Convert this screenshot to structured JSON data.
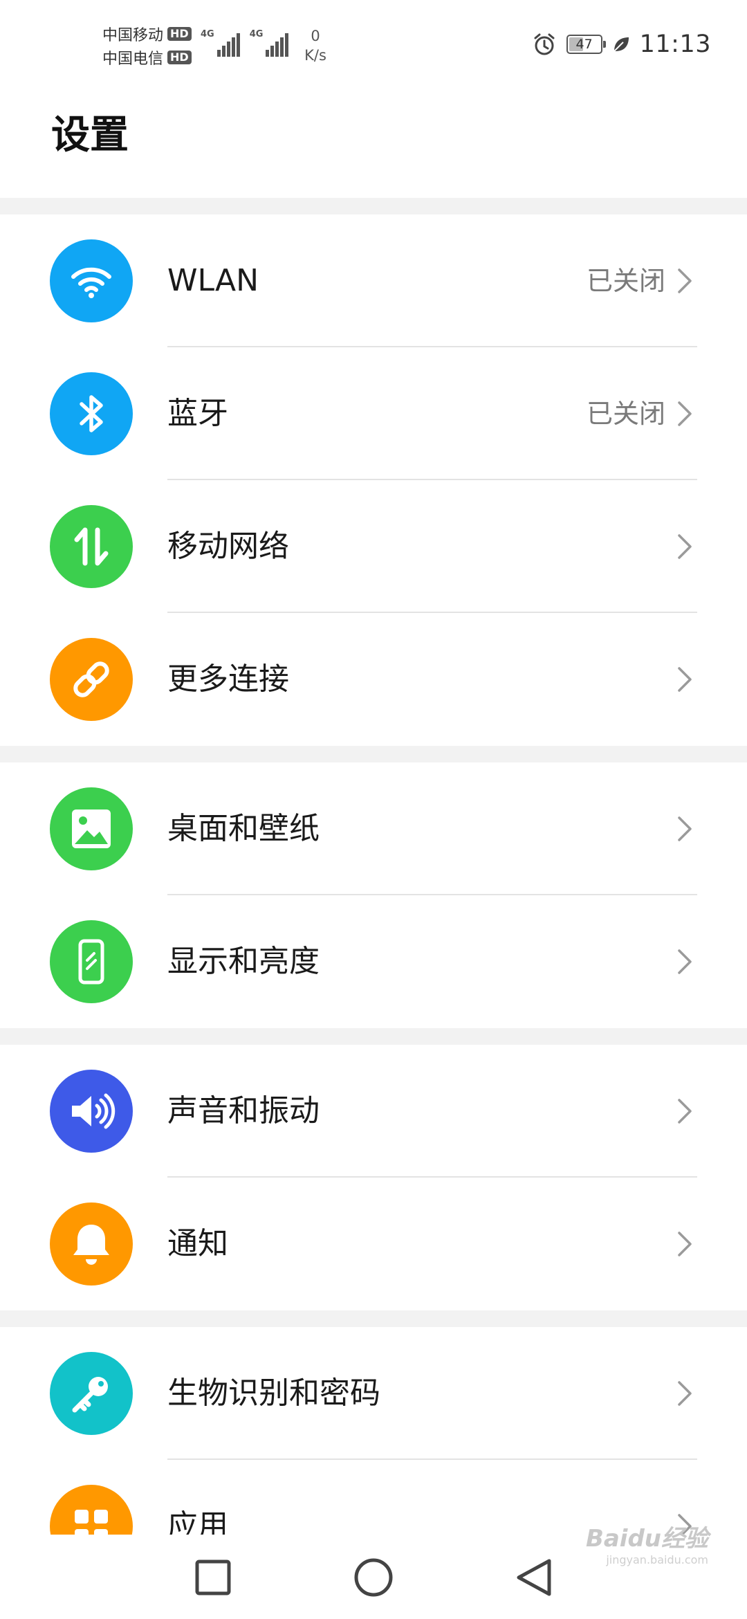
{
  "status_bar": {
    "carrier1": "中国移动",
    "carrier2": "中国电信",
    "hd_badge": "HD",
    "network_tag": "4G",
    "speed_value": "0",
    "speed_unit": "K/s",
    "battery_level": "47",
    "time": "11:13"
  },
  "header": {
    "title": "设置"
  },
  "settings_groups": [
    {
      "items": [
        {
          "label": "WLAN",
          "value": "已关闭",
          "icon": "wifi-icon",
          "color": "#10a6f4"
        },
        {
          "label": "蓝牙",
          "value": "已关闭",
          "icon": "bluetooth-icon",
          "color": "#10a6f4"
        },
        {
          "label": "移动网络",
          "value": "",
          "icon": "mobile-data-icon",
          "color": "#3ccf4e"
        },
        {
          "label": "更多连接",
          "value": "",
          "icon": "link-icon",
          "color": "#ff9800"
        }
      ]
    },
    {
      "items": [
        {
          "label": "桌面和壁纸",
          "value": "",
          "icon": "wallpaper-icon",
          "color": "#3ccf4e"
        },
        {
          "label": "显示和亮度",
          "value": "",
          "icon": "display-icon",
          "color": "#3ccf4e"
        }
      ]
    },
    {
      "items": [
        {
          "label": "声音和振动",
          "value": "",
          "icon": "sound-icon",
          "color": "#3e5ae8"
        },
        {
          "label": "通知",
          "value": "",
          "icon": "bell-icon",
          "color": "#ff9800"
        }
      ]
    },
    {
      "items": [
        {
          "label": "生物识别和密码",
          "value": "",
          "icon": "key-icon",
          "color": "#12c2c9"
        },
        {
          "label": "应用",
          "value": "",
          "icon": "apps-icon",
          "color": "#ff9800"
        }
      ]
    }
  ],
  "navigation": {
    "recents": "square-icon",
    "home": "circle-icon",
    "back": "triangle-back-icon"
  },
  "watermark": {
    "brand": "Baidu经验",
    "url": "jingyan.baidu.com"
  }
}
